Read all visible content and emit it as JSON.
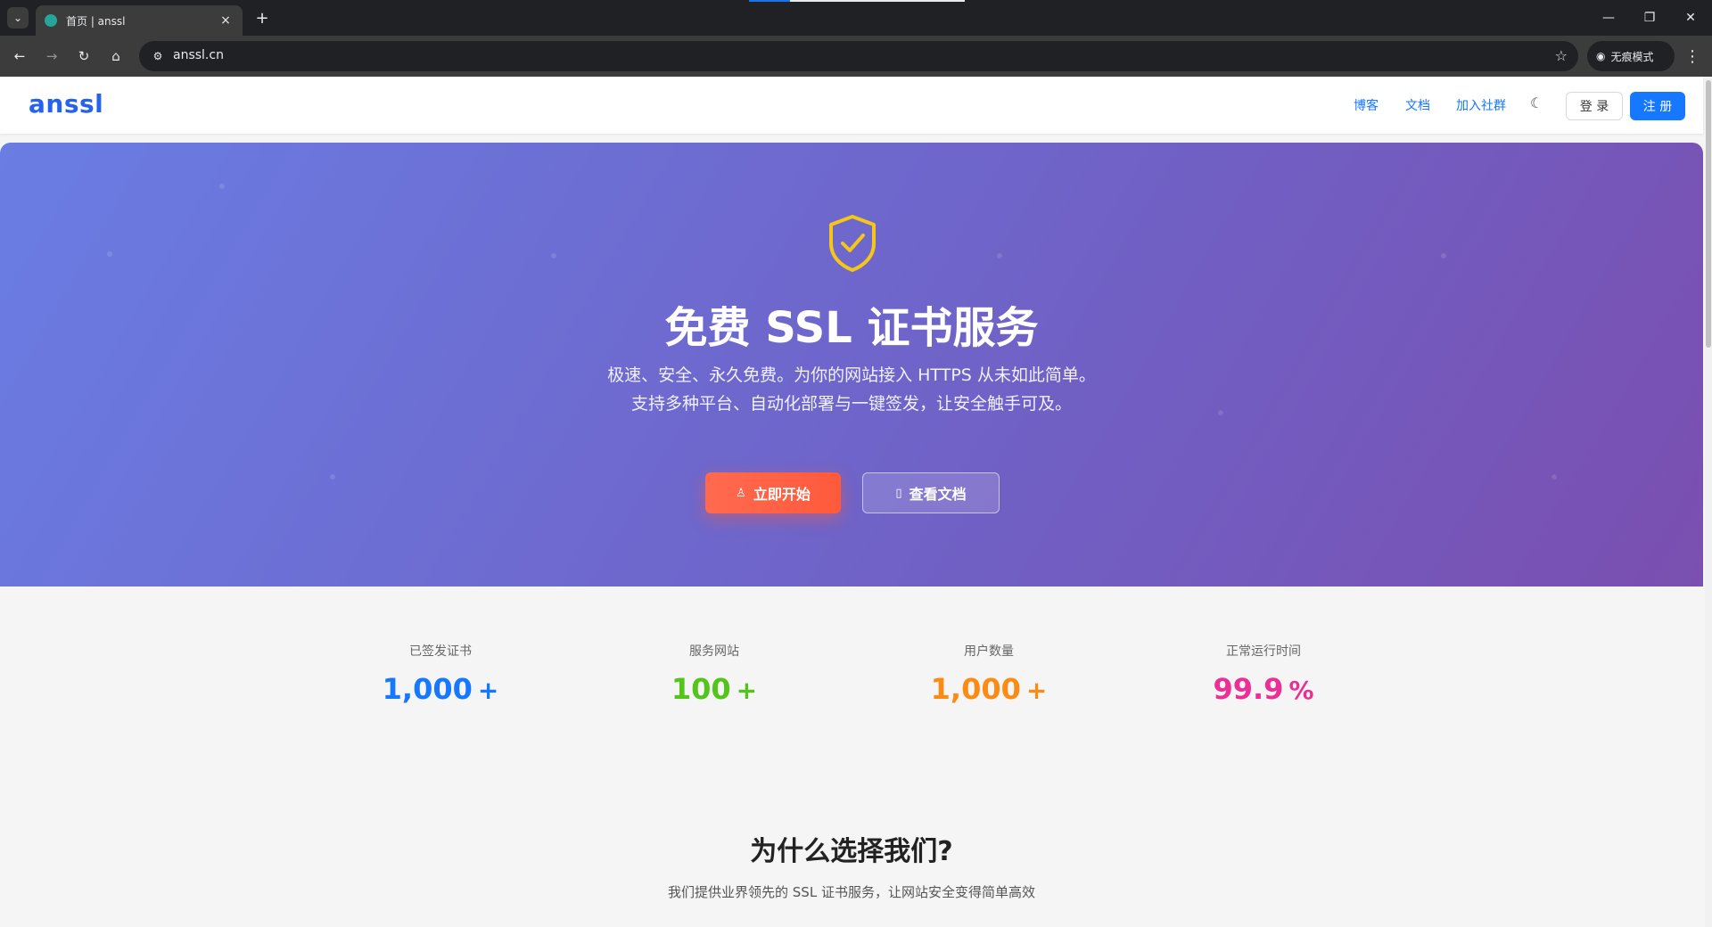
{
  "browser": {
    "tab_title": "首页 | anssl",
    "close_glyph": "×",
    "new_tab_glyph": "+",
    "url": "anssl.cn",
    "incognito_label": "无痕模式"
  },
  "header": {
    "logo": "anssl",
    "nav": [
      "博客",
      "文档",
      "加入社群"
    ],
    "login": "登 录",
    "register": "注 册"
  },
  "hero": {
    "title": "免费 SSL 证书服务",
    "subtitle_line1": "极速、安全、永久免费。为你的网站接入 HTTPS 从未如此简单。",
    "subtitle_line2": "支持多种平台、自动化部署与一键签发，让安全触手可及。",
    "primary_button": "立即开始",
    "secondary_button": "查看文档",
    "shield_color": "#f5c518"
  },
  "stats": [
    {
      "label": "已签发证书",
      "value": "1,000",
      "suffix": "+",
      "color": "#1677ff"
    },
    {
      "label": "服务网站",
      "value": "100",
      "suffix": "+",
      "color": "#52c41a"
    },
    {
      "label": "用户数量",
      "value": "1,000",
      "suffix": "+",
      "color": "#fa8c16"
    },
    {
      "label": "正常运行时间",
      "value": "99.9",
      "suffix": "%",
      "color": "#eb2f96"
    }
  ],
  "why": {
    "title": "为什么选择我们?",
    "subtitle": "我们提供业界领先的 SSL 证书服务，让网站安全变得简单高效"
  }
}
